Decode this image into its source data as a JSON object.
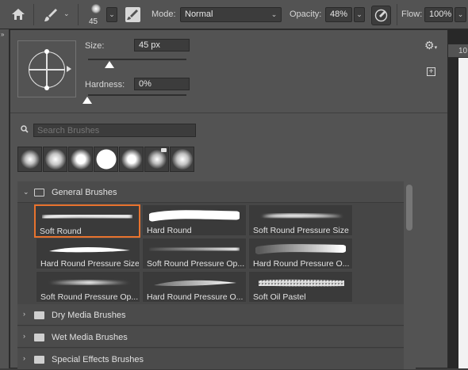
{
  "toolbar": {
    "brush_size_value": "45",
    "mode_label": "Mode:",
    "mode_value": "Normal",
    "opacity_label": "Opacity:",
    "opacity_value": "48%",
    "flow_label": "Flow:",
    "flow_value": "100%"
  },
  "ruler": {
    "value": "10"
  },
  "brush_panel": {
    "size_label": "Size:",
    "size_value": "45 px",
    "size_slider_fraction": 0.23,
    "hardness_label": "Hardness:",
    "hardness_value": "0%",
    "hardness_slider_fraction": 0.0,
    "search_placeholder": "Search Brushes",
    "recent_brushes": [
      "soft-round",
      "soft-round",
      "soft-round",
      "hard-round",
      "soft-round",
      "soft-round-pressure",
      "soft-round"
    ],
    "groups": [
      {
        "name": "General Brushes",
        "expanded": true,
        "brushes": [
          {
            "name": "Soft Round",
            "selected": true,
            "stroke": "soft"
          },
          {
            "name": "Hard Round",
            "selected": false,
            "stroke": "hard"
          },
          {
            "name": "Soft Round Pressure Size",
            "selected": false,
            "stroke": "taper-soft"
          },
          {
            "name": "Hard Round Pressure Size",
            "selected": false,
            "stroke": "taper-hard"
          },
          {
            "name": "Soft Round Pressure Op...",
            "selected": false,
            "stroke": "soft-fade"
          },
          {
            "name": "Hard Round Pressure O...",
            "selected": false,
            "stroke": "hard-fade"
          },
          {
            "name": "Soft Round Pressure Op...",
            "selected": false,
            "stroke": "taper-soft-fade"
          },
          {
            "name": "Hard Round Pressure O...",
            "selected": false,
            "stroke": "taper-hard-fade"
          },
          {
            "name": "Soft Oil Pastel",
            "selected": false,
            "stroke": "pastel"
          }
        ]
      },
      {
        "name": "Dry Media Brushes",
        "expanded": false
      },
      {
        "name": "Wet Media Brushes",
        "expanded": false
      },
      {
        "name": "Special Effects Brushes",
        "expanded": false
      }
    ]
  },
  "colors": {
    "selection_border": "#e8732e",
    "panel_bg": "#535353",
    "toolbar_bg": "#535353"
  },
  "icons": [
    "home-icon",
    "brush-icon",
    "brush-settings-icon",
    "airbrush-icon",
    "gear-icon",
    "new-preset-icon",
    "search-icon",
    "folder-icon",
    "chevron-icon"
  ]
}
